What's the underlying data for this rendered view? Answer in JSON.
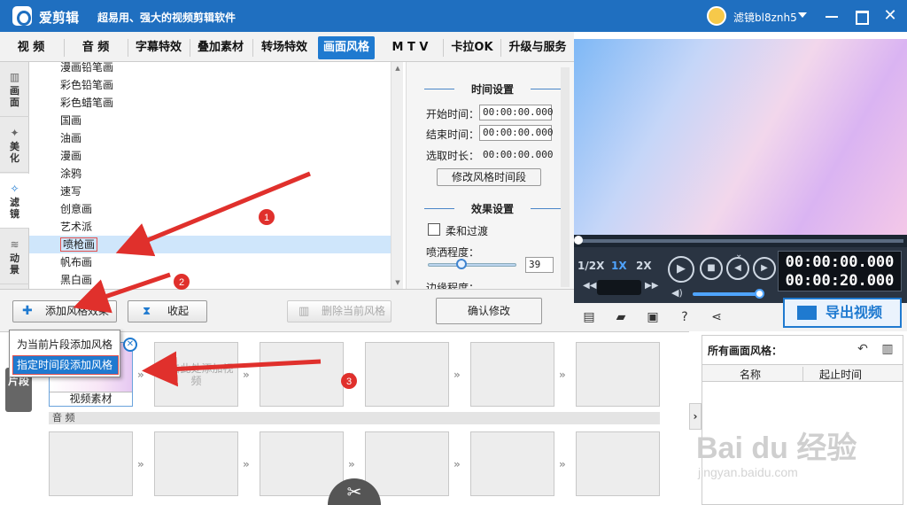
{
  "titlebar": {
    "app_name": "爱剪辑",
    "slogan": "超易用、强大的视频剪辑软件",
    "user_name": "滤镜bl8znh5",
    "close_glyph": "✕"
  },
  "tabs": [
    {
      "label": "视 频"
    },
    {
      "label": "音 频"
    },
    {
      "label": "字幕特效"
    },
    {
      "label": "叠加素材"
    },
    {
      "label": "转场特效"
    },
    {
      "label": "画面风格"
    },
    {
      "label": "M T V"
    },
    {
      "label": "卡拉OK"
    },
    {
      "label": "升级与服务"
    }
  ],
  "sidetabs": [
    {
      "label": "画面",
      "icon": "grid-icon"
    },
    {
      "label": "美化",
      "icon": "wand-icon"
    },
    {
      "label": "滤镜",
      "icon": "magic-icon"
    },
    {
      "label": "动景",
      "icon": "wave-icon"
    }
  ],
  "style_list": {
    "items": [
      "漫画铅笔画",
      "彩色铅笔画",
      "彩色蜡笔画",
      "国画",
      "油画",
      "漫画",
      "涂鸦",
      "速写",
      "创意画",
      "艺术派",
      "喷枪画",
      "帆布画",
      "黑白画"
    ],
    "selected": "喷枪画"
  },
  "settings": {
    "time_title": "时间设置",
    "start_label": "开始时间：",
    "start_value": "00:00:00.000",
    "end_label": "结束时间：",
    "end_value": "00:00:00.000",
    "duration_label": "选取时长：",
    "duration_value": "00:00:00.000",
    "modify_time_button": "修改风格时间段",
    "effect_title": "效果设置",
    "soft_transition_label": "柔和过渡",
    "spray_label": "喷洒程度：",
    "spray_value": "39",
    "edge_label": "边缘程度："
  },
  "actions": {
    "add_style": "添加风格效果",
    "collapse": "收起",
    "delete_style": "删除当前风格",
    "confirm": "确认修改"
  },
  "popup_menu": {
    "items": [
      "为当前片段添加风格",
      "指定时间段添加风格"
    ],
    "selected_index": 1
  },
  "player": {
    "speed_options": [
      "1/2X",
      "1X",
      "2X"
    ],
    "active_speed": "1X",
    "current_time": "00:00:00.000",
    "total_time": "00:00:20.000",
    "play_progress": 0,
    "volume": 0.9
  },
  "toolbar": {
    "export_label": "导出视频"
  },
  "timeline": {
    "segment_tab": "片段",
    "video_clip_label": "视频素材",
    "add_video_hint": "双击此处添加视频",
    "audio_label": "音 频"
  },
  "right_panel": {
    "title": "所有画面风格：",
    "col_name": "名称",
    "col_time": "起止时间"
  },
  "annotations": [
    "1",
    "2",
    "3"
  ],
  "watermark": {
    "logo_text": "Bai du 经验",
    "url": "jingyan.baidu.com"
  },
  "colors": {
    "accent": "#1f7ad0",
    "titlebar": "#1f6fc0",
    "arrow_red": "#e0302c"
  }
}
